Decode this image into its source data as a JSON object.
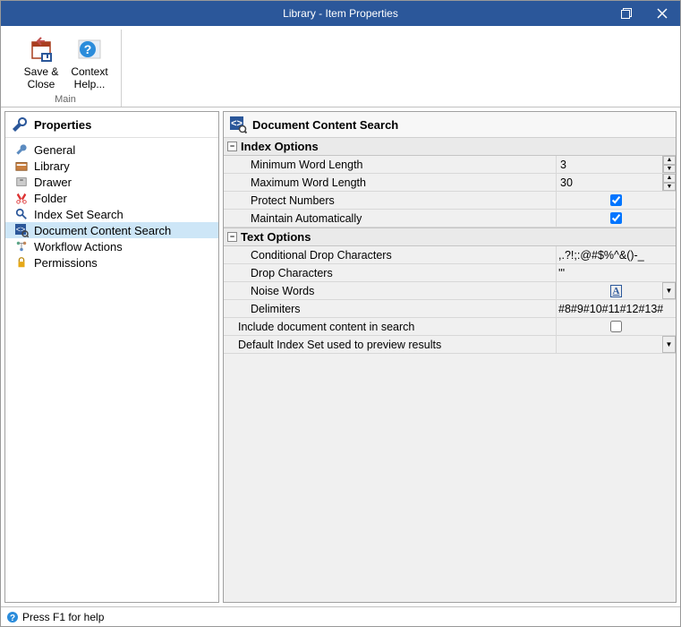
{
  "window": {
    "title": "Library - Item Properties"
  },
  "ribbon": {
    "save_close": {
      "line1": "Save &",
      "line2": "Close"
    },
    "context_help": {
      "line1": "Context",
      "line2": "Help..."
    },
    "group_label": "Main"
  },
  "sidebar": {
    "header": "Properties",
    "items": [
      {
        "label": "General"
      },
      {
        "label": "Library"
      },
      {
        "label": "Drawer"
      },
      {
        "label": "Folder"
      },
      {
        "label": "Index Set Search"
      },
      {
        "label": "Document Content Search"
      },
      {
        "label": "Workflow Actions"
      },
      {
        "label": "Permissions"
      }
    ]
  },
  "panel": {
    "title": "Document Content Search",
    "sections": {
      "index": "Index Options",
      "text": "Text Options"
    },
    "rows": {
      "min_word_length": {
        "label": "Minimum Word Length",
        "value": "3"
      },
      "max_word_length": {
        "label": "Maximum Word Length",
        "value": "30"
      },
      "protect_numbers": {
        "label": "Protect Numbers",
        "checked": true
      },
      "maintain_auto": {
        "label": "Maintain Automatically",
        "checked": true
      },
      "cond_drop": {
        "label": "Conditional Drop Characters",
        "value": ",.?!;:@#$%^&()-_"
      },
      "drop_chars": {
        "label": "Drop Characters",
        "value": "'''"
      },
      "noise_words": {
        "label": "Noise Words",
        "badge": "A"
      },
      "delimiters": {
        "label": "Delimiters",
        "value": "#8#9#10#11#12#13#"
      },
      "include_content": {
        "label": "Include document content in search",
        "checked": false
      },
      "default_index": {
        "label": "Default Index Set used to preview results",
        "value": ""
      }
    }
  },
  "statusbar": {
    "text": "Press F1 for help"
  }
}
